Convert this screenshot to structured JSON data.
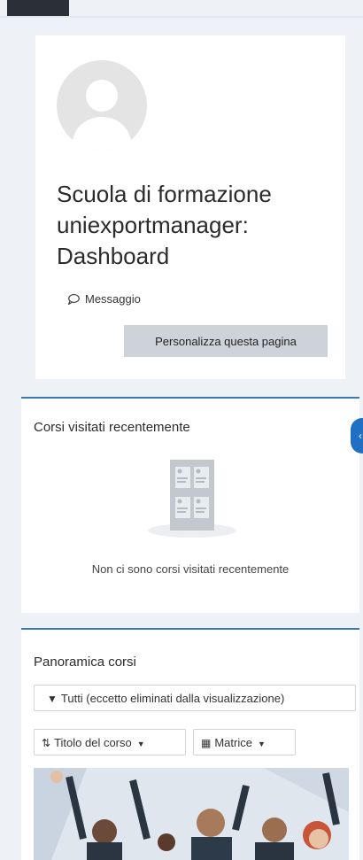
{
  "profile": {
    "title": "Scuola di formazione uniexportmanager: Dashboard",
    "message_label": "Messaggio",
    "customize_label": "Personalizza questa pagina"
  },
  "recent_courses": {
    "title": "Corsi visitati recentemente",
    "empty_text": "Non ci sono corsi visitati recentemente"
  },
  "course_overview": {
    "title": "Panoramica corsi",
    "filter_label": "Tutti (eccetto eliminati dalla visualizzazione)",
    "sort_label": "Titolo del corso",
    "view_label": "Matrice"
  },
  "colors": {
    "accent": "#3b78b8",
    "handle": "#1f6fc5",
    "button_bg": "#ced3da",
    "page_bg": "#eef1f6"
  }
}
